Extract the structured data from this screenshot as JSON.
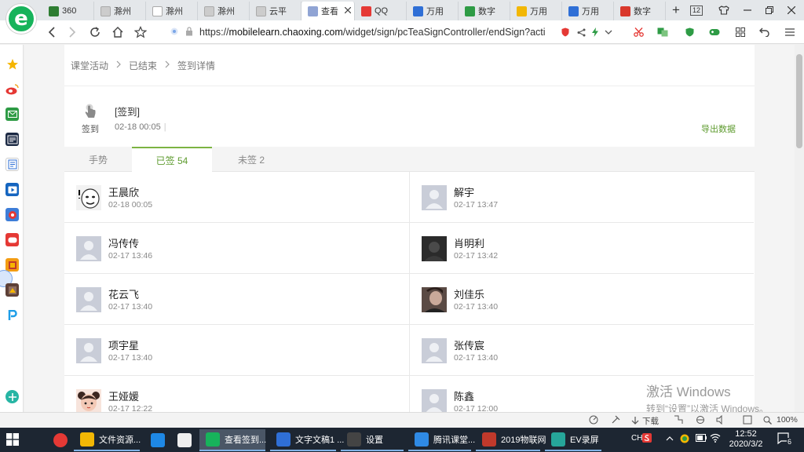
{
  "browser": {
    "logo_letter": "e",
    "tabs": [
      {
        "label": "360",
        "color": "#2e7d32"
      },
      {
        "label": "滁州",
        "color": "#cccccc"
      },
      {
        "label": "滁州",
        "color": "#ffffff"
      },
      {
        "label": "滁州",
        "color": "#cccccc"
      },
      {
        "label": "云平",
        "color": "#cccccc"
      },
      {
        "label": "查看",
        "color": "#90a4d4",
        "active": true
      },
      {
        "label": "QQ",
        "color": "#e53935"
      },
      {
        "label": "万用",
        "color": "#2f6fd6"
      },
      {
        "label": "数字",
        "color": "#2e9b45"
      },
      {
        "label": "万用",
        "color": "#f2b705"
      },
      {
        "label": "万用",
        "color": "#2f6fd6"
      },
      {
        "label": "数字",
        "color": "#d9382c"
      }
    ],
    "new_tab_symbol": "+",
    "tab_count": "12",
    "url_scheme": "https://",
    "url_host": "mobilelearn.chaoxing.com",
    "url_path": "/widget/sign/pcTeaSignController/endSign?acti"
  },
  "breadcrumb": {
    "items": [
      "课堂活动",
      "已结束",
      "签到详情"
    ]
  },
  "sign": {
    "icon_label": "签到",
    "title": "[签到]",
    "time": "02-18 00:05",
    "export_label": "导出数据"
  },
  "page_tabs": [
    {
      "label": "手势"
    },
    {
      "label": "已签 54",
      "active": true
    },
    {
      "label": "未签 2"
    }
  ],
  "students": [
    {
      "name": "王晨欣",
      "time": "02-18 00:05",
      "avatar": "meme"
    },
    {
      "name": "解宇",
      "time": "02-17 13:47",
      "avatar": "default"
    },
    {
      "name": "冯传传",
      "time": "02-17 13:46",
      "avatar": "default"
    },
    {
      "name": "肖明利",
      "time": "02-17 13:42",
      "avatar": "dark"
    },
    {
      "name": "花云飞",
      "time": "02-17 13:40",
      "avatar": "default"
    },
    {
      "name": "刘佳乐",
      "time": "02-17 13:40",
      "avatar": "photo"
    },
    {
      "name": "项宇星",
      "time": "02-17 13:40",
      "avatar": "default"
    },
    {
      "name": "张传宸",
      "time": "02-17 13:40",
      "avatar": "default"
    },
    {
      "name": "王娅媛",
      "time": "02-17 12:22",
      "avatar": "girl"
    },
    {
      "name": "陈鑫",
      "time": "02-17 12:00",
      "avatar": "default"
    }
  ],
  "watermark": {
    "line1": "激活 Windows",
    "line2": "转到“设置”以激活 Windows。"
  },
  "statusbar": {
    "download_label": "下载",
    "zoom": "100%"
  },
  "taskbar": {
    "items": [
      {
        "label": "",
        "color": "#e53935",
        "kind": "chrome"
      },
      {
        "label": "文件资源...",
        "color": "#f2b705"
      },
      {
        "label": "",
        "color": "#1e88e5"
      },
      {
        "label": "",
        "color": "#eeeeee"
      },
      {
        "label": "查看签到...",
        "color": "#17b35b",
        "active": true
      },
      {
        "label": "文字文稿1 ...",
        "color": "#2f6fd6"
      },
      {
        "label": "设置",
        "color": "#444444"
      },
      {
        "label": "腾讯课堂...",
        "color": "#2f8ae5"
      },
      {
        "label": "2019物联网",
        "color": "#c0392b"
      },
      {
        "label": "EV录屏",
        "color": "#26a69a"
      }
    ],
    "input_method": "CH",
    "time": "12:52",
    "date": "2020/3/2",
    "notifications": "6"
  }
}
